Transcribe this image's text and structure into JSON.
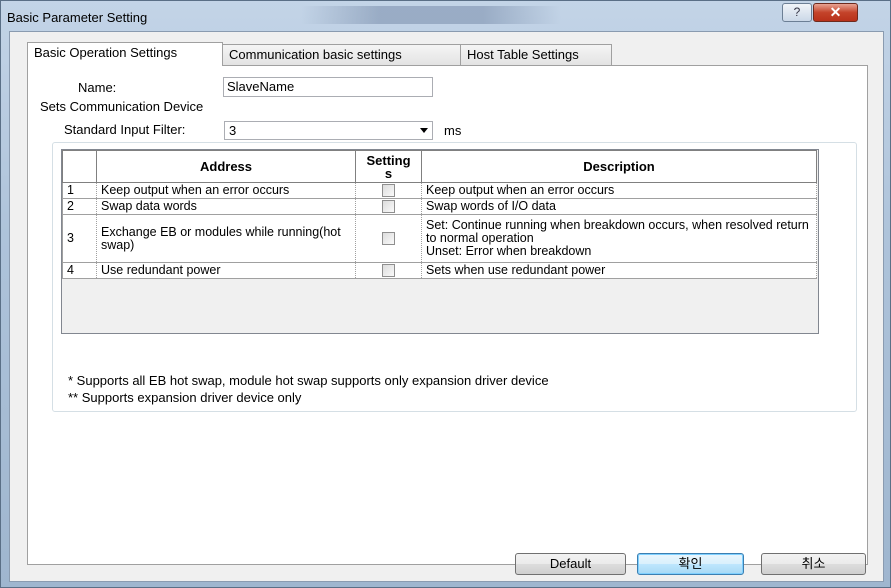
{
  "window": {
    "title": "Basic Parameter Setting",
    "help_label": "?",
    "close_label": "✕"
  },
  "tabs": [
    {
      "label": "Basic Operation Settings",
      "active": true
    },
    {
      "label": "Communication basic settings",
      "active": false
    },
    {
      "label": "Host Table Settings",
      "active": false
    }
  ],
  "name_field": {
    "label": "Name:",
    "value": "SlaveName"
  },
  "group": {
    "title": "Sets Communication Device"
  },
  "filter": {
    "label": "Standard Input Filter:",
    "value": "3",
    "unit": "ms"
  },
  "table": {
    "headers": {
      "address": "Address",
      "settings": "Setting s",
      "description": "Description"
    },
    "rows": [
      {
        "num": "1",
        "address": "Keep output when an error occurs",
        "checked": false,
        "description": "Keep output when an error occurs"
      },
      {
        "num": "2",
        "address": "Swap data words",
        "checked": false,
        "description": "Swap words of I/O data"
      },
      {
        "num": "3",
        "address": "Exchange EB or modules while running(hot swap)",
        "checked": false,
        "description": "Set: Continue running when breakdown occurs, when resolved return to normal operation\nUnset: Error when breakdown"
      },
      {
        "num": "4",
        "address": "Use redundant power",
        "checked": false,
        "description": "Sets when use redundant power"
      }
    ]
  },
  "notes": {
    "note1": "* Supports all EB hot swap, module hot swap supports only expansion driver device",
    "note2": "** Supports expansion driver device only"
  },
  "buttons": {
    "default": "Default",
    "ok": "확인",
    "cancel": "취소"
  }
}
